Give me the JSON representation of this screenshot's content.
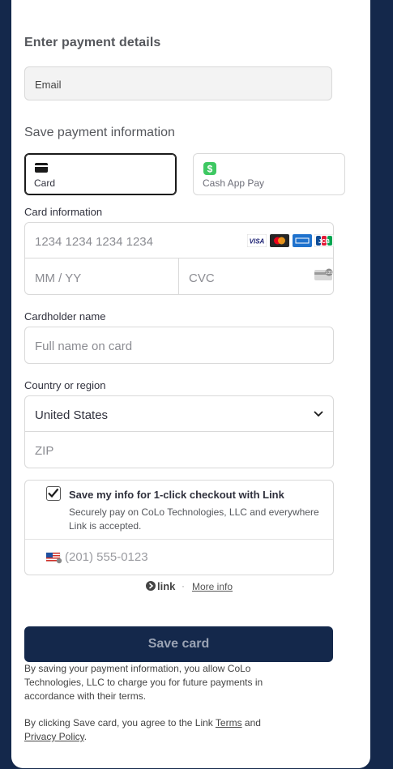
{
  "header": {
    "title": "Enter payment details"
  },
  "email": {
    "placeholder": "Email"
  },
  "save_section": {
    "title": "Save payment information"
  },
  "tabs": [
    {
      "label": "Card",
      "icon": "credit-card-icon",
      "active": true
    },
    {
      "label": "Cash App Pay",
      "icon": "cash-app-icon",
      "active": false
    }
  ],
  "card": {
    "label": "Card information",
    "number_placeholder": "1234 1234 1234 1234",
    "expiry_placeholder": "MM / YY",
    "cvc_placeholder": "CVC",
    "brands": [
      "VISA",
      "mastercard-icon",
      "amex-icon",
      "JCB"
    ]
  },
  "cardholder": {
    "label": "Cardholder name",
    "placeholder": "Full name on card"
  },
  "country": {
    "label": "Country or region",
    "value": "United States",
    "zip_placeholder": "ZIP"
  },
  "link_optin": {
    "checked": true,
    "title": "Save my info for 1-click checkout with Link",
    "description": "Securely pay on CoLo Technologies, LLC and everywhere Link is accepted.",
    "phone_placeholder": "(201) 555-0123"
  },
  "link_footer": {
    "brand": "link",
    "separator": "·",
    "more_info": "More info"
  },
  "save_button": {
    "label": "Save card"
  },
  "terms": {
    "paragraph1": "By saving your payment information, you allow CoLo Technologies, LLC to charge you for future payments in accordance with their terms.",
    "p2_prefix": "By clicking Save card, you agree to the Link ",
    "p2_terms": "Terms",
    "p2_and": " and",
    "p2_privacy": "Privacy Policy",
    "p2_suffix": "."
  },
  "colors": {
    "background": "#14284b",
    "button": "#14284b",
    "cashapp": "#3ec862"
  }
}
